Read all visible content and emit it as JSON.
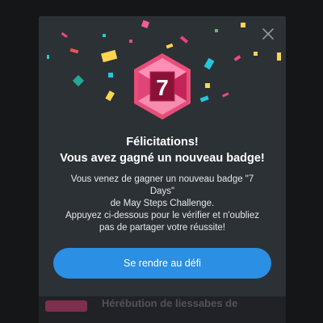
{
  "modal": {
    "badge_number": "7",
    "title_line1": "Félicitations!",
    "title_line2": "Vous avez gagné un nouveau badge!",
    "desc_line1": "Vous venez de gagner un nouveau badge \"7",
    "desc_line2": "Days\"",
    "desc_line3": "de May Steps Challenge.",
    "desc_line4": "Appuyez ci-dessous pour le vérifier et n'oubliez",
    "desc_line5": "pas de partager votre réussite!",
    "cta_label": "Se rendre au défi",
    "close_icon": "close-icon"
  },
  "background": {
    "list_item_text": "Hérébution de liessabes de"
  },
  "colors": {
    "modal_bg": "#2c3136",
    "cta_bg": "#2b8fe3",
    "badge_outer": "#e84d7a",
    "badge_inner": "#b51e4d",
    "badge_number_bg": "#7a0f2f"
  }
}
